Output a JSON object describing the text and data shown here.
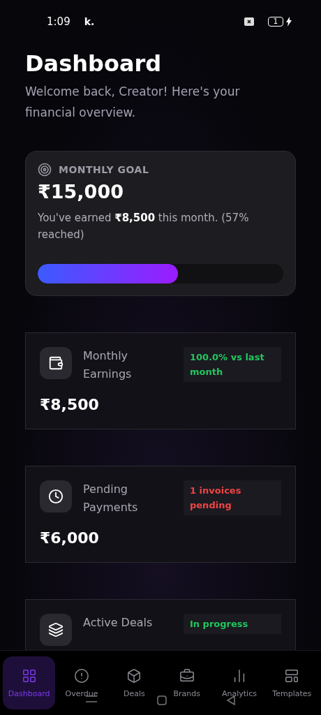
{
  "status_bar": {
    "time": "1:09",
    "app_mark": "k.",
    "battery": "1"
  },
  "header": {
    "title": "Dashboard",
    "subtitle": "Welcome back, Creator! Here's your financial overview."
  },
  "goal": {
    "label": "MONTHLY GOAL",
    "amount": "₹15,000",
    "note": "You've earned **₹8,500** this month. (57% reached)",
    "level": 0.57
  },
  "stats": [
    {
      "title": "Monthly Earnings",
      "badge": "100.0% vs last month",
      "color": "#22c55e",
      "value": "₹8,500"
    },
    {
      "title": "Pending Payments",
      "badge": "1 invoices pending",
      "color": "#ef4444",
      "value": "₹6,000"
    },
    {
      "title": "Active Deals",
      "badge": "In progress",
      "color": "#22c55e"
    }
  ],
  "nav": [
    {
      "label": "Dashboard",
      "selected": true
    },
    {
      "label": "Overdue",
      "selected": false
    },
    {
      "label": "Deals",
      "selected": false
    },
    {
      "label": "Brands",
      "selected": false
    },
    {
      "label": "Analytics",
      "selected": false
    },
    {
      "label": "Templates",
      "selected": false
    }
  ]
}
